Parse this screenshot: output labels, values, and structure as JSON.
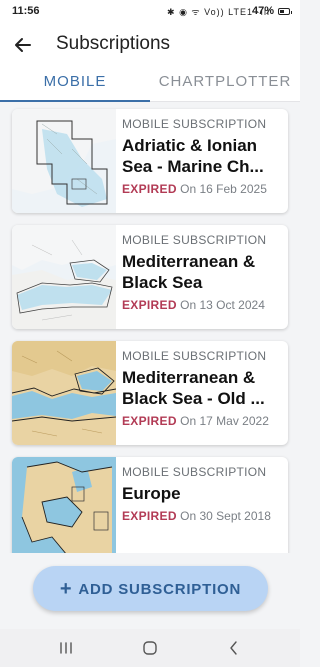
{
  "status_bar": {
    "time": "11:56",
    "indicators": "✱ ◉ ᯤ Vo)) LTE1 ·ıll",
    "battery": "47%"
  },
  "app_bar": {
    "title": "Subscriptions",
    "back_icon": "arrow-left-icon"
  },
  "tabs": [
    {
      "label": "MOBILE",
      "active": true
    },
    {
      "label": "CHARTPLOTTER",
      "active": false
    }
  ],
  "subscriptions": [
    {
      "label": "MOBILE SUBSCRIPTION",
      "title": "Adriatic & Ionian Sea - Marine Ch...",
      "status": "EXPIRED",
      "date": "On 16 Feb 2025"
    },
    {
      "label": "MOBILE SUBSCRIPTION",
      "title": "Mediterranean & Black Sea",
      "status": "EXPIRED",
      "date": "On 13 Oct 2024"
    },
    {
      "label": "MOBILE SUBSCRIPTION",
      "title": "Mediterranean & Black Sea - Old ...",
      "status": "EXPIRED",
      "date": "On 17 Mav 2022"
    },
    {
      "label": "MOBILE SUBSCRIPTION",
      "title": "Europe",
      "status": "EXPIRED",
      "date": "On 30 Sept 2018"
    }
  ],
  "add_button": {
    "label": "ADD SUBSCRIPTION",
    "icon": "plus-icon"
  },
  "nav_bar": {
    "recents_icon": "recents-icon",
    "home_icon": "home-icon",
    "back_icon": "nav-back-icon"
  },
  "colors": {
    "accent": "#3b6fa8",
    "expired": "#b23b55",
    "button_bg": "#b9d4f4"
  }
}
